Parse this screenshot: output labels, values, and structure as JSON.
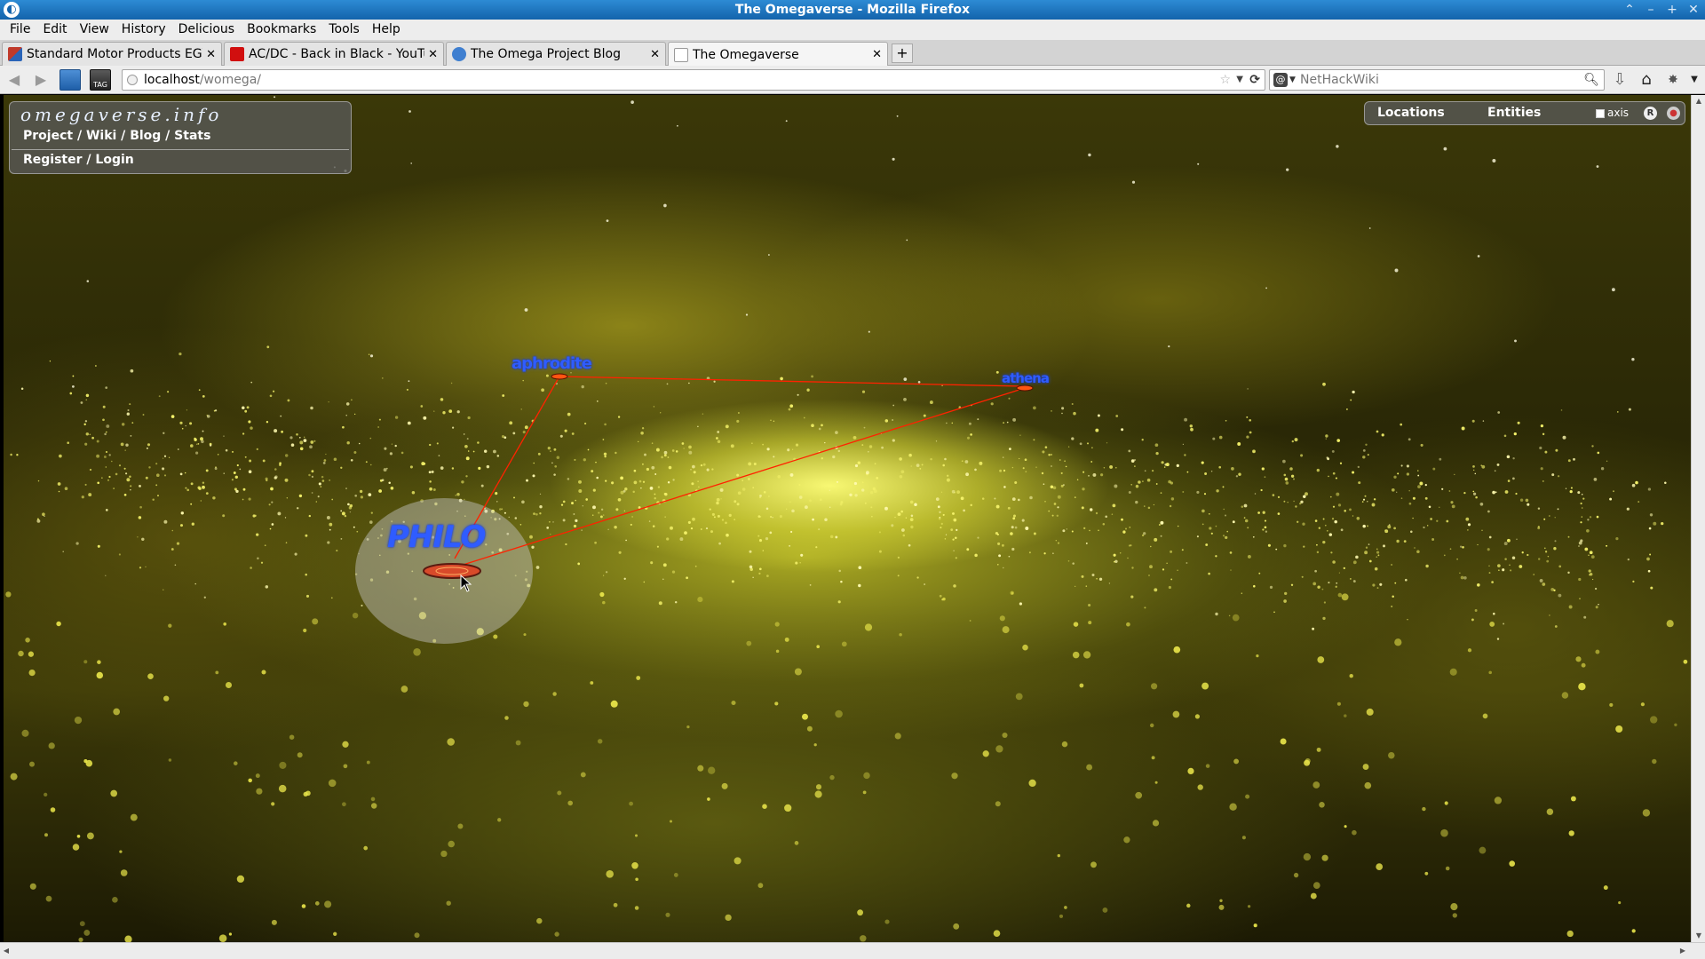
{
  "window": {
    "title": "The Omegaverse - Mozilla Firefox"
  },
  "menu": [
    "File",
    "Edit",
    "View",
    "History",
    "Delicious",
    "Bookmarks",
    "Tools",
    "Help"
  ],
  "tabs": [
    {
      "label": "Standard Motor Products EGV...",
      "favicon_color": "#c03a2b"
    },
    {
      "label": "AC/DC - Back in Black - YouTube",
      "favicon_color": "#d10f0f"
    },
    {
      "label": "The Omega Project Blog",
      "favicon_color": "#3f7fd0"
    },
    {
      "label": "The Omegaverse",
      "favicon_color": "#ffffff"
    }
  ],
  "newtab_label": "+",
  "address": {
    "host": "localhost",
    "path": "/womega/"
  },
  "search": {
    "placeholder": "NetHackWiki",
    "engine_letter": "@"
  },
  "site": {
    "brand": "omegaverse.info",
    "links": [
      "Project",
      "Wiki",
      "Blog",
      "Stats"
    ],
    "link_sep": " / ",
    "auth": [
      "Register",
      "Login"
    ]
  },
  "controls": {
    "locations": "Locations",
    "entities": "Entities",
    "axis_label": "axis",
    "axis_checked": false
  },
  "scene": {
    "labels": [
      "aphrodite",
      "athena",
      "philo"
    ],
    "colors": {
      "label": "#2f5cff",
      "link": "#ff2200",
      "selection": "#c8c8c8",
      "nebula": "#d6d635"
    }
  }
}
